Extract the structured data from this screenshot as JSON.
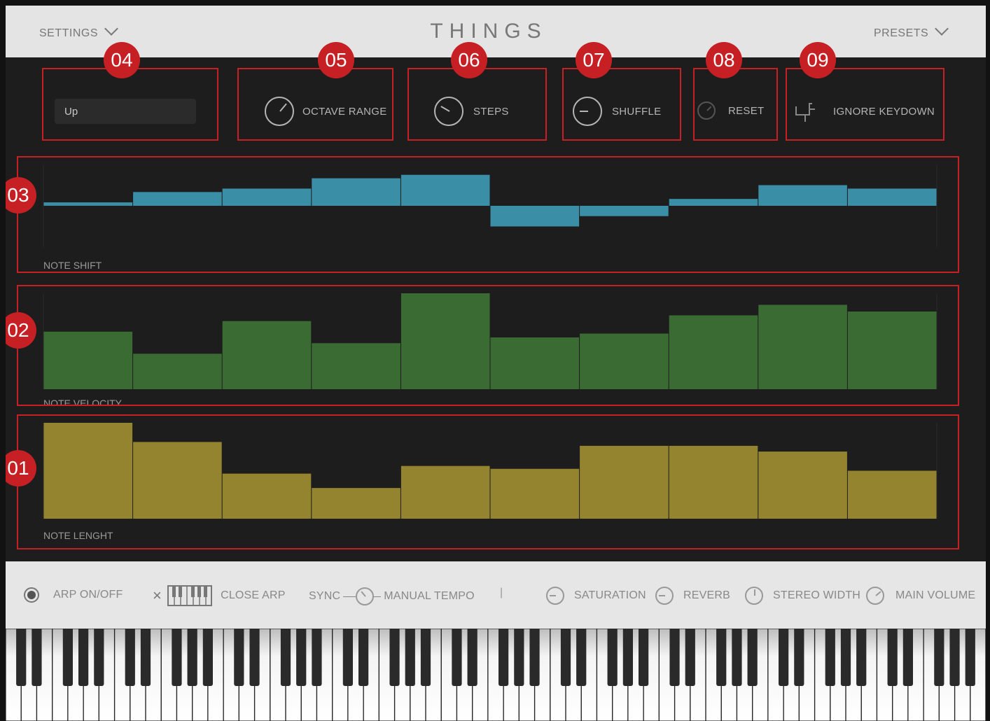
{
  "header": {
    "title": "THINGS",
    "settings_label": "SETTINGS",
    "presets_label": "PRESETS"
  },
  "controls": {
    "direction": {
      "value": "Up"
    },
    "octave_range": {
      "label": "OCTAVE RANGE"
    },
    "steps": {
      "label": "STEPS"
    },
    "shuffle": {
      "label": "SHUFFLE"
    },
    "reset": {
      "label": "RESET"
    },
    "ignore_keydown": {
      "label": "IGNORE  KEYDOWN"
    }
  },
  "annotations": [
    "04",
    "05",
    "06",
    "07",
    "08",
    "09",
    "03",
    "02",
    "01"
  ],
  "chart_data": [
    {
      "type": "bar",
      "label": "NOTE SHIFT",
      "color": "#3a8ea6",
      "baseline": 0,
      "ylim": [
        -12,
        12
      ],
      "values": [
        1,
        4,
        5,
        8,
        9,
        -6,
        -3,
        2,
        6,
        5
      ]
    },
    {
      "type": "bar",
      "label": "NOTE VELOCITY",
      "color": "#3a6b32",
      "ylim": [
        0,
        100
      ],
      "values": [
        60,
        37,
        71,
        48,
        100,
        54,
        58,
        77,
        88,
        81
      ]
    },
    {
      "type": "bar",
      "label": "NOTE LENGHT",
      "color": "#94842f",
      "ylim": [
        0,
        100
      ],
      "values": [
        100,
        80,
        47,
        32,
        55,
        52,
        76,
        76,
        70,
        50
      ]
    }
  ],
  "bottom": {
    "arp_label": "ARP ON/OFF",
    "close_arp_label": "CLOSE ARP",
    "sync_label": "SYNC",
    "manual_tempo_label": "MANUAL TEMPO",
    "divider": "|",
    "saturation_label": "SATURATION",
    "reverb_label": "REVERB",
    "stereo_width_label": "STEREO WIDTH",
    "main_volume_label": "MAIN VOLUME"
  }
}
